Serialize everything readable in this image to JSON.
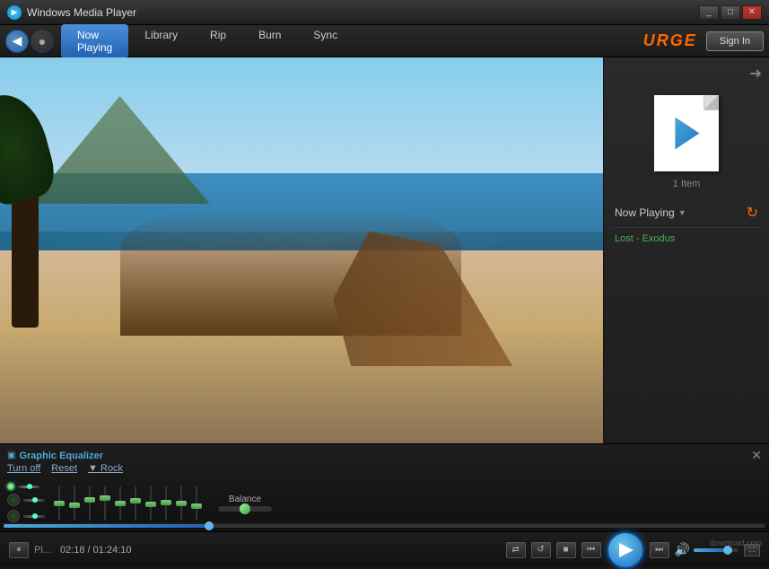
{
  "window": {
    "title": "Windows Media Player",
    "icon": "⏵"
  },
  "nav": {
    "back_label": "◀",
    "fwd_label": "●",
    "tabs": [
      "Now Playing",
      "Library",
      "Rip",
      "Burn",
      "Sync"
    ],
    "active_tab": "Now Playing",
    "urge_label": "URGE",
    "sign_in_label": "Sign In"
  },
  "player": {
    "item_count": "1 Item",
    "now_playing_label": "Now Playing",
    "playlist_item": "Lost - Exodus",
    "time_current": "02:18",
    "time_total": "01:24:10",
    "status": "Pl..."
  },
  "equalizer": {
    "title": "Graphic Equalizer",
    "turn_off": "Turn off",
    "reset": "Reset",
    "preset_label": "Rock",
    "balance_label": "Balance",
    "close": "✕",
    "sliders": [
      {
        "id": "s1",
        "pct": 50
      },
      {
        "id": "s2",
        "pct": 40
      },
      {
        "id": "s3",
        "pct": 55
      },
      {
        "id": "s4",
        "pct": 60
      },
      {
        "id": "s5",
        "pct": 50
      },
      {
        "id": "s6",
        "pct": 55
      },
      {
        "id": "s7",
        "pct": 48
      },
      {
        "id": "s8",
        "pct": 52
      },
      {
        "id": "s9",
        "pct": 50
      },
      {
        "id": "s10",
        "pct": 46
      }
    ]
  },
  "controls": {
    "prev_label": "⏮",
    "rew_label": "◀◀",
    "stop_label": "■",
    "fwd_label": "▶▶",
    "next_label": "⏭",
    "play_label": "▶",
    "shuffle_label": "⇄",
    "repeat_label": "↺",
    "volume_label": "🔊",
    "fullscreen_label": "⛶"
  },
  "watermark": "download.com"
}
